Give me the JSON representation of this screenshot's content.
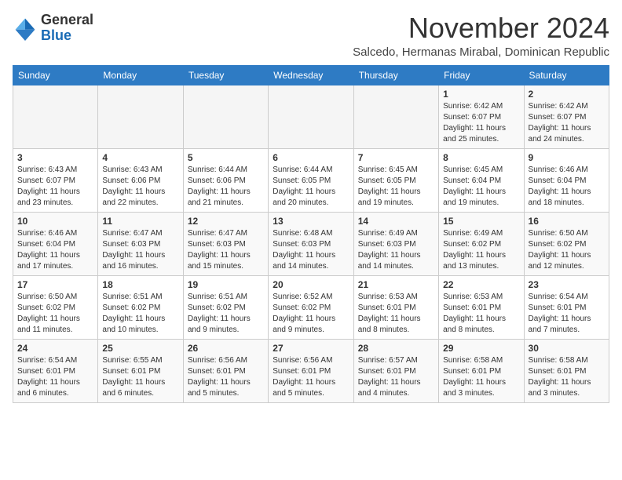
{
  "logo": {
    "general": "General",
    "blue": "Blue"
  },
  "header": {
    "month_year": "November 2024",
    "location": "Salcedo, Hermanas Mirabal, Dominican Republic"
  },
  "days_of_week": [
    "Sunday",
    "Monday",
    "Tuesday",
    "Wednesday",
    "Thursday",
    "Friday",
    "Saturday"
  ],
  "weeks": [
    [
      {
        "day": "",
        "info": ""
      },
      {
        "day": "",
        "info": ""
      },
      {
        "day": "",
        "info": ""
      },
      {
        "day": "",
        "info": ""
      },
      {
        "day": "",
        "info": ""
      },
      {
        "day": "1",
        "info": "Sunrise: 6:42 AM\nSunset: 6:07 PM\nDaylight: 11 hours and 25 minutes."
      },
      {
        "day": "2",
        "info": "Sunrise: 6:42 AM\nSunset: 6:07 PM\nDaylight: 11 hours and 24 minutes."
      }
    ],
    [
      {
        "day": "3",
        "info": "Sunrise: 6:43 AM\nSunset: 6:07 PM\nDaylight: 11 hours and 23 minutes."
      },
      {
        "day": "4",
        "info": "Sunrise: 6:43 AM\nSunset: 6:06 PM\nDaylight: 11 hours and 22 minutes."
      },
      {
        "day": "5",
        "info": "Sunrise: 6:44 AM\nSunset: 6:06 PM\nDaylight: 11 hours and 21 minutes."
      },
      {
        "day": "6",
        "info": "Sunrise: 6:44 AM\nSunset: 6:05 PM\nDaylight: 11 hours and 20 minutes."
      },
      {
        "day": "7",
        "info": "Sunrise: 6:45 AM\nSunset: 6:05 PM\nDaylight: 11 hours and 19 minutes."
      },
      {
        "day": "8",
        "info": "Sunrise: 6:45 AM\nSunset: 6:04 PM\nDaylight: 11 hours and 19 minutes."
      },
      {
        "day": "9",
        "info": "Sunrise: 6:46 AM\nSunset: 6:04 PM\nDaylight: 11 hours and 18 minutes."
      }
    ],
    [
      {
        "day": "10",
        "info": "Sunrise: 6:46 AM\nSunset: 6:04 PM\nDaylight: 11 hours and 17 minutes."
      },
      {
        "day": "11",
        "info": "Sunrise: 6:47 AM\nSunset: 6:03 PM\nDaylight: 11 hours and 16 minutes."
      },
      {
        "day": "12",
        "info": "Sunrise: 6:47 AM\nSunset: 6:03 PM\nDaylight: 11 hours and 15 minutes."
      },
      {
        "day": "13",
        "info": "Sunrise: 6:48 AM\nSunset: 6:03 PM\nDaylight: 11 hours and 14 minutes."
      },
      {
        "day": "14",
        "info": "Sunrise: 6:49 AM\nSunset: 6:03 PM\nDaylight: 11 hours and 14 minutes."
      },
      {
        "day": "15",
        "info": "Sunrise: 6:49 AM\nSunset: 6:02 PM\nDaylight: 11 hours and 13 minutes."
      },
      {
        "day": "16",
        "info": "Sunrise: 6:50 AM\nSunset: 6:02 PM\nDaylight: 11 hours and 12 minutes."
      }
    ],
    [
      {
        "day": "17",
        "info": "Sunrise: 6:50 AM\nSunset: 6:02 PM\nDaylight: 11 hours and 11 minutes."
      },
      {
        "day": "18",
        "info": "Sunrise: 6:51 AM\nSunset: 6:02 PM\nDaylight: 11 hours and 10 minutes."
      },
      {
        "day": "19",
        "info": "Sunrise: 6:51 AM\nSunset: 6:02 PM\nDaylight: 11 hours and 9 minutes."
      },
      {
        "day": "20",
        "info": "Sunrise: 6:52 AM\nSunset: 6:02 PM\nDaylight: 11 hours and 9 minutes."
      },
      {
        "day": "21",
        "info": "Sunrise: 6:53 AM\nSunset: 6:01 PM\nDaylight: 11 hours and 8 minutes."
      },
      {
        "day": "22",
        "info": "Sunrise: 6:53 AM\nSunset: 6:01 PM\nDaylight: 11 hours and 8 minutes."
      },
      {
        "day": "23",
        "info": "Sunrise: 6:54 AM\nSunset: 6:01 PM\nDaylight: 11 hours and 7 minutes."
      }
    ],
    [
      {
        "day": "24",
        "info": "Sunrise: 6:54 AM\nSunset: 6:01 PM\nDaylight: 11 hours and 6 minutes."
      },
      {
        "day": "25",
        "info": "Sunrise: 6:55 AM\nSunset: 6:01 PM\nDaylight: 11 hours and 6 minutes."
      },
      {
        "day": "26",
        "info": "Sunrise: 6:56 AM\nSunset: 6:01 PM\nDaylight: 11 hours and 5 minutes."
      },
      {
        "day": "27",
        "info": "Sunrise: 6:56 AM\nSunset: 6:01 PM\nDaylight: 11 hours and 5 minutes."
      },
      {
        "day": "28",
        "info": "Sunrise: 6:57 AM\nSunset: 6:01 PM\nDaylight: 11 hours and 4 minutes."
      },
      {
        "day": "29",
        "info": "Sunrise: 6:58 AM\nSunset: 6:01 PM\nDaylight: 11 hours and 3 minutes."
      },
      {
        "day": "30",
        "info": "Sunrise: 6:58 AM\nSunset: 6:01 PM\nDaylight: 11 hours and 3 minutes."
      }
    ]
  ]
}
